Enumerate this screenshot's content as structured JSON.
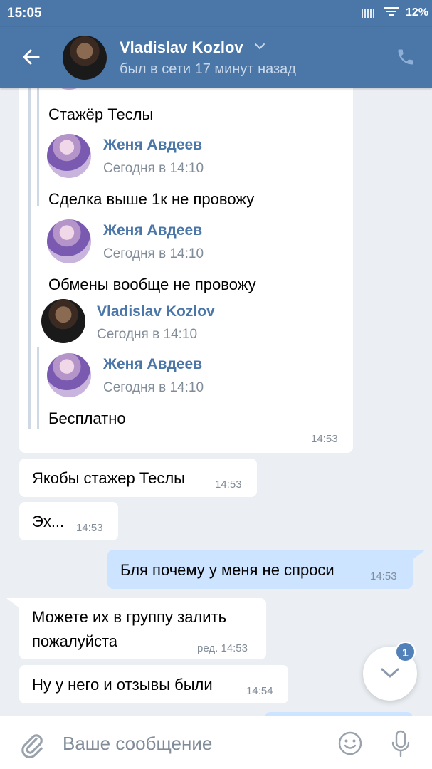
{
  "status_bar": {
    "time": "15:05",
    "battery": "12%"
  },
  "header": {
    "name": "Vladislav Kozlov",
    "status": "был в сети 17 минут назад"
  },
  "forwarded": {
    "top_text": "Стажёр Теслы",
    "items": [
      {
        "author": "Женя Авдеев",
        "date": "Сегодня в 14:10",
        "text": "Сделка выше 1к не провожу"
      },
      {
        "author": "Женя Авдеев",
        "date": "Сегодня в 14:10",
        "text": "Обмены вообще не провожу"
      }
    ],
    "nested_author": "Vladislav Kozlov",
    "nested_date": "Сегодня в 14:10",
    "inner": {
      "author": "Женя Авдеев",
      "date": "Сегодня в 14:10",
      "text": "Бесплатно"
    },
    "time": "14:53"
  },
  "messages": [
    {
      "text": "Якобы стажер Теслы",
      "time": "14:53",
      "direction": "in"
    },
    {
      "text": "Эх...",
      "time": "14:53",
      "direction": "in"
    },
    {
      "text": "Бля почему у меня не спроси",
      "time": "14:53",
      "direction": "out"
    },
    {
      "text_line1": "Можете их в группу залить",
      "text_line2": "пожалуйста",
      "time": "ред. 14:53",
      "direction": "in"
    },
    {
      "text": "Ну у него и отзывы были",
      "time": "14:54",
      "direction": "in"
    }
  ],
  "input": {
    "placeholder": "Ваше сообщение"
  },
  "scroll_button": {
    "badge": "1"
  },
  "colors": {
    "header": "#4a76a8",
    "background": "#ebeff3",
    "outgoing": "#cce4ff",
    "link": "#4a76a8"
  }
}
